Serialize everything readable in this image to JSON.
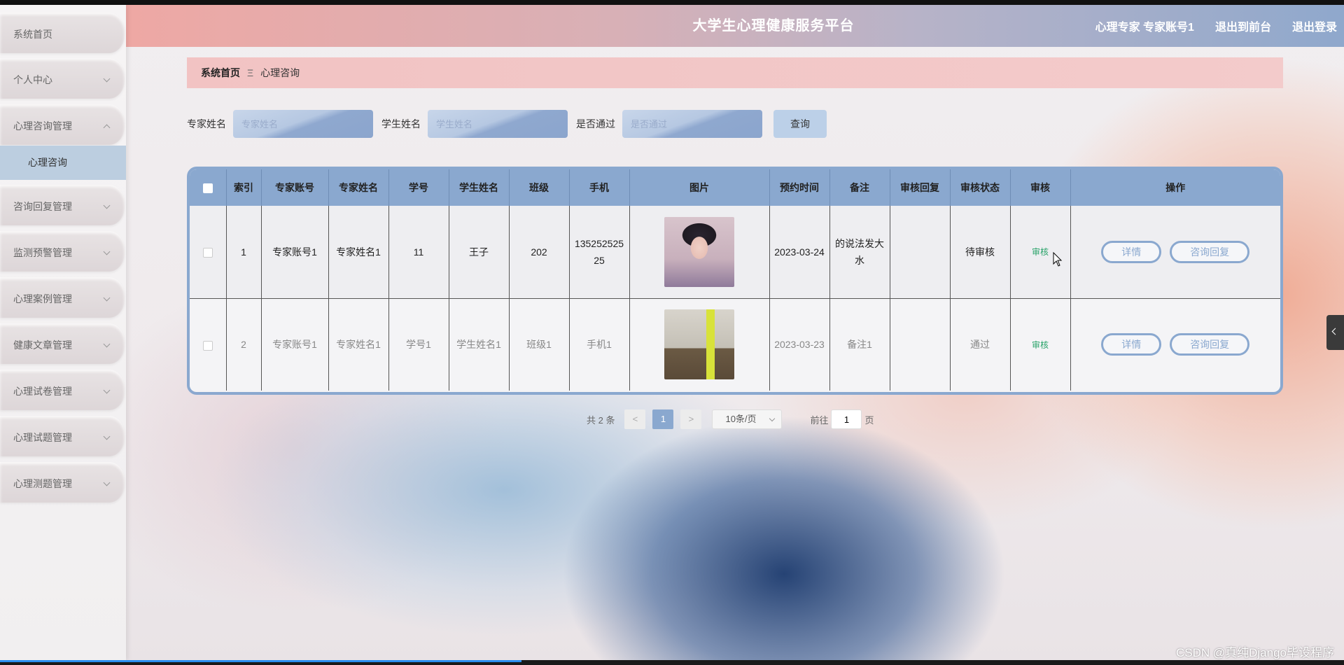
{
  "header": {
    "title": "大学生心理健康服务平台",
    "user": "心理专家 专家账号1",
    "front_link": "退出到前台",
    "logout_link": "退出登录"
  },
  "sidebar": {
    "items": [
      {
        "label": "系统首页"
      },
      {
        "label": "个人中心"
      },
      {
        "label": "心理咨询管理"
      },
      {
        "label": "咨询回复管理"
      },
      {
        "label": "监测预警管理"
      },
      {
        "label": "心理案例管理"
      },
      {
        "label": "健康文章管理"
      },
      {
        "label": "心理试卷管理"
      },
      {
        "label": "心理试题管理"
      },
      {
        "label": "心理测题管理"
      }
    ],
    "submenu": {
      "label": "心理咨询"
    }
  },
  "breadcrumb": {
    "home": "系统首页",
    "separator": "Ξ",
    "current": "心理咨询"
  },
  "search": {
    "expert_label": "专家姓名",
    "expert_placeholder": "专家姓名",
    "student_label": "学生姓名",
    "student_placeholder": "学生姓名",
    "pass_label": "是否通过",
    "pass_placeholder": "是否通过",
    "query_button": "查询"
  },
  "table": {
    "headers": [
      "索引",
      "专家账号",
      "专家姓名",
      "学号",
      "学生姓名",
      "班级",
      "手机",
      "图片",
      "预约时间",
      "备注",
      "审核回复",
      "审核状态",
      "审核",
      "操作"
    ],
    "rows": [
      {
        "index": "1",
        "expert_account": "专家账号1",
        "expert_name": "专家姓名1",
        "student_id": "11",
        "student_name": "王子",
        "class": "202",
        "phone": "13525252525",
        "image": "person-photo",
        "time": "2023-03-24",
        "note": "的说法发大水",
        "reply": "",
        "status": "待审核",
        "audit": "审核",
        "detail": "详情",
        "consult_reply": "咨询回复"
      },
      {
        "index": "2",
        "expert_account": "专家账号1",
        "expert_name": "专家姓名1",
        "student_id": "学号1",
        "student_name": "学生姓名1",
        "class": "班级1",
        "phone": "手机1",
        "image": "room-photo",
        "time": "2023-03-23",
        "note": "备注1",
        "reply": "",
        "status": "通过",
        "audit": "审核",
        "detail": "详情",
        "consult_reply": "咨询回复"
      }
    ]
  },
  "pagination": {
    "total": "共 2 条",
    "prev": "<",
    "current_page": "1",
    "next": ">",
    "page_size": "10条/页",
    "goto_label": "前往",
    "goto_value": "1",
    "page_suffix": "页"
  },
  "watermark": "CSDN @真纯Django毕设程序",
  "colors": {
    "accent": "#8aa8cf",
    "audit_green": "#2aa36a",
    "breadcrumb_bg": "#f2c3c3"
  }
}
